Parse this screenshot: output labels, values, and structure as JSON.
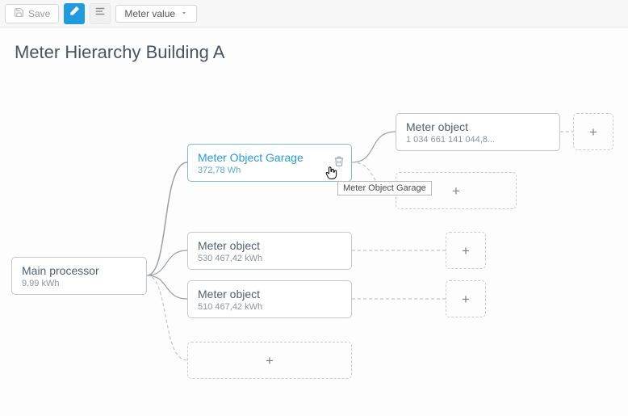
{
  "toolbar": {
    "save_label": "Save",
    "dropdown_label": "Meter value"
  },
  "header": {
    "title": "Meter Hierarchy Building A"
  },
  "tooltip": {
    "text": "Meter Object Garage"
  },
  "nodes": {
    "root": {
      "title": "Main processor",
      "sub": "9,99 kWh"
    },
    "garage": {
      "title": "Meter Object Garage",
      "sub": "372,78 Wh"
    },
    "m1": {
      "title": "Meter object",
      "sub": "530 467,42 kWh"
    },
    "m2": {
      "title": "Meter object",
      "sub": "510 467,42 kWh"
    },
    "m3": {
      "title": "Meter object",
      "sub": "1 034 661 141 044,8..."
    }
  },
  "icons": {
    "plus": "+"
  }
}
